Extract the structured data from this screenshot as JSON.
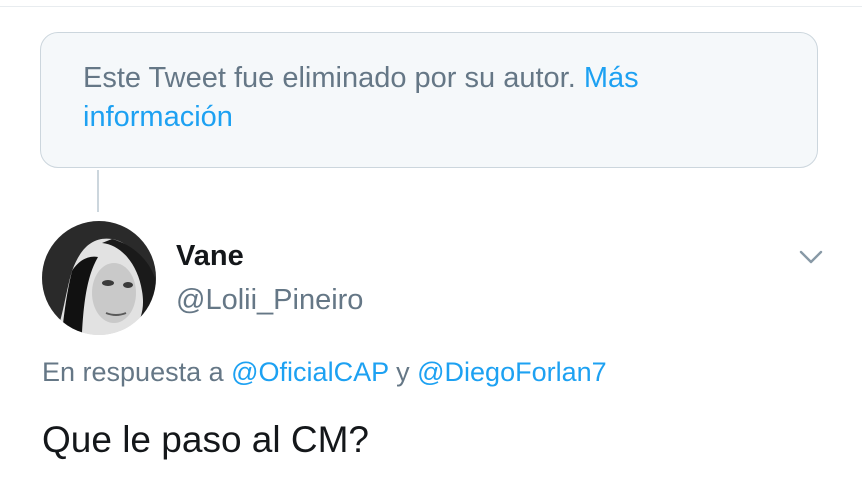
{
  "deleted_notice": {
    "text": "Este Tweet fue eliminado por su autor.",
    "link_label": "Más información"
  },
  "tweet": {
    "author": {
      "display_name": "Vane",
      "handle": "@Lolii_Pineiro"
    },
    "reply_context": {
      "prefix": "En respuesta a",
      "mention_1": "@OficialCAP",
      "joiner": "y",
      "mention_2": "@DiegoForlan7"
    },
    "text": "Que le paso al CM?"
  },
  "icons": {
    "menu": "chevron-down-icon"
  },
  "colors": {
    "link": "#1da1f2",
    "secondary_text": "#657786",
    "primary_text": "#14171a",
    "notice_background": "#f5f8fa",
    "border": "#ccd6dd"
  }
}
